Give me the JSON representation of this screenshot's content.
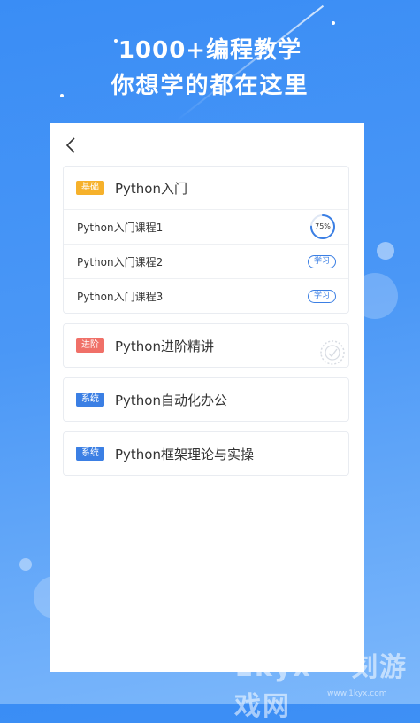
{
  "header": {
    "headline_line1": "1000+编程教学",
    "headline_line2": "你想学的都在这里"
  },
  "nav": {
    "back_icon": "chevron-left-icon"
  },
  "courses": [
    {
      "tag": "基础",
      "tag_color": "#f6b12b",
      "title": "Python入门",
      "lessons": [
        {
          "label": "Python入门课程1",
          "progress": 0.75,
          "progress_text": "75%"
        },
        {
          "label": "Python入门课程2",
          "action": "学习"
        },
        {
          "label": "Python入门课程3",
          "action": "学习"
        }
      ]
    },
    {
      "tag": "进阶",
      "tag_color": "#f07068",
      "title": "Python进阶精讲"
    },
    {
      "tag": "系统",
      "tag_color": "#3b7fe4",
      "title": "Python自动化办公"
    },
    {
      "tag": "系统",
      "tag_color": "#3b7fe4",
      "title": "Python框架理论与实操"
    }
  ],
  "colors": {
    "accent": "#3b7fe4",
    "background": "#3a8df5"
  },
  "watermark": {
    "brand": "1kyx 一刻游戏网",
    "url": "www.1kyx.com"
  }
}
